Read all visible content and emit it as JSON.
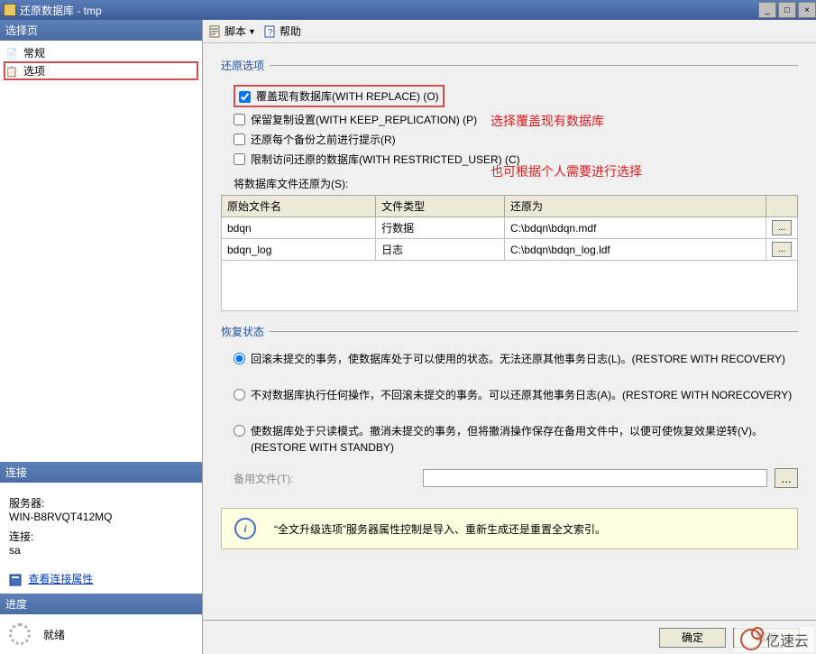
{
  "titlebar": {
    "text": "还原数据库 - tmp"
  },
  "left": {
    "select_page_header": "选择页",
    "pages": {
      "general": "常规",
      "options": "选项"
    },
    "connection_header": "连接",
    "server_label": "服务器:",
    "server_value": "WIN-B8RVQT412MQ",
    "conn_label": "连接:",
    "conn_value": "sa",
    "view_props": "查看连接属性",
    "progress_header": "进度",
    "progress_status": "就绪"
  },
  "toolbar": {
    "script": "脚本",
    "help": "帮助"
  },
  "restore_options": {
    "legend": "还原选项",
    "overwrite": "覆盖现有数据库(WITH REPLACE) (O)",
    "keep_replication": "保留复制设置(WITH KEEP_REPLICATION) (P)",
    "prompt_each": "还原每个备份之前进行提示(R)",
    "restricted": "限制访问还原的数据库(WITH RESTRICTED_USER) (C)",
    "restore_files_as": "将数据库文件还原为(S):"
  },
  "annotations": {
    "a1": "选择覆盖现有数据库",
    "a2": "也可根据个人需要进行选择"
  },
  "table": {
    "h1": "原始文件名",
    "h2": "文件类型",
    "h3": "还原为",
    "rows": [
      {
        "name": "bdqn",
        "type": "行数据",
        "path": "C:\\bdqn\\bdqn.mdf"
      },
      {
        "name": "bdqn_log",
        "type": "日志",
        "path": "C:\\bdqn\\bdqn_log.ldf"
      }
    ]
  },
  "recovery": {
    "legend": "恢复状态",
    "r1": "回滚未提交的事务，使数据库处于可以使用的状态。无法还原其他事务日志(L)。(RESTORE WITH RECOVERY)",
    "r2": "不对数据库执行任何操作，不回滚未提交的事务。可以还原其他事务日志(A)。(RESTORE WITH NORECOVERY)",
    "r3": "使数据库处于只读模式。撤消未提交的事务，但将撤消操作保存在备用文件中，以便可使恢复效果逆转(V)。(RESTORE WITH STANDBY)",
    "standby_label": "备用文件(T):"
  },
  "info": {
    "text": "“全文升级选项”服务器属性控制是导入、重新生成还是重置全文索引。"
  },
  "footer": {
    "ok": "确定",
    "cancel": "取消"
  },
  "watermark": "亿速云"
}
